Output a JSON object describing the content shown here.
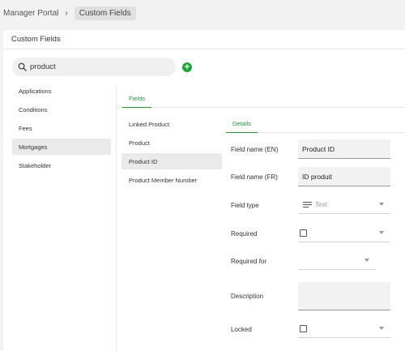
{
  "breadcrumb": {
    "root": "Manager Portal",
    "separator": "›",
    "current": "Custom Fields"
  },
  "card": {
    "title": "Custom Fields"
  },
  "search": {
    "value": "product",
    "placeholder": ""
  },
  "add_button": {
    "label": "+"
  },
  "sidebar": {
    "items": [
      {
        "label": "Applications"
      },
      {
        "label": "Conditions"
      },
      {
        "label": "Fees"
      },
      {
        "label": "Mortgages",
        "active": true
      },
      {
        "label": "Stakeholder"
      }
    ]
  },
  "tabs": {
    "fields": "Fields",
    "details": "Details"
  },
  "fields": [
    {
      "label": "Linked Product"
    },
    {
      "label": "Product"
    },
    {
      "label": "Product ID",
      "active": true
    },
    {
      "label": "Product Member Number"
    }
  ],
  "details": {
    "field_name_en": {
      "label": "Field name (EN)",
      "value": "Product ID"
    },
    "field_name_fr": {
      "label": "Field name (FR)",
      "value": "ID produit"
    },
    "field_type": {
      "label": "Field type",
      "value": "Text"
    },
    "required": {
      "label": "Required"
    },
    "required_for": {
      "label": "Required for"
    },
    "description": {
      "label": "Description"
    },
    "locked": {
      "label": "Locked"
    }
  },
  "colors": {
    "accent": "#2a8f3d",
    "add_button": "#22a33a"
  }
}
